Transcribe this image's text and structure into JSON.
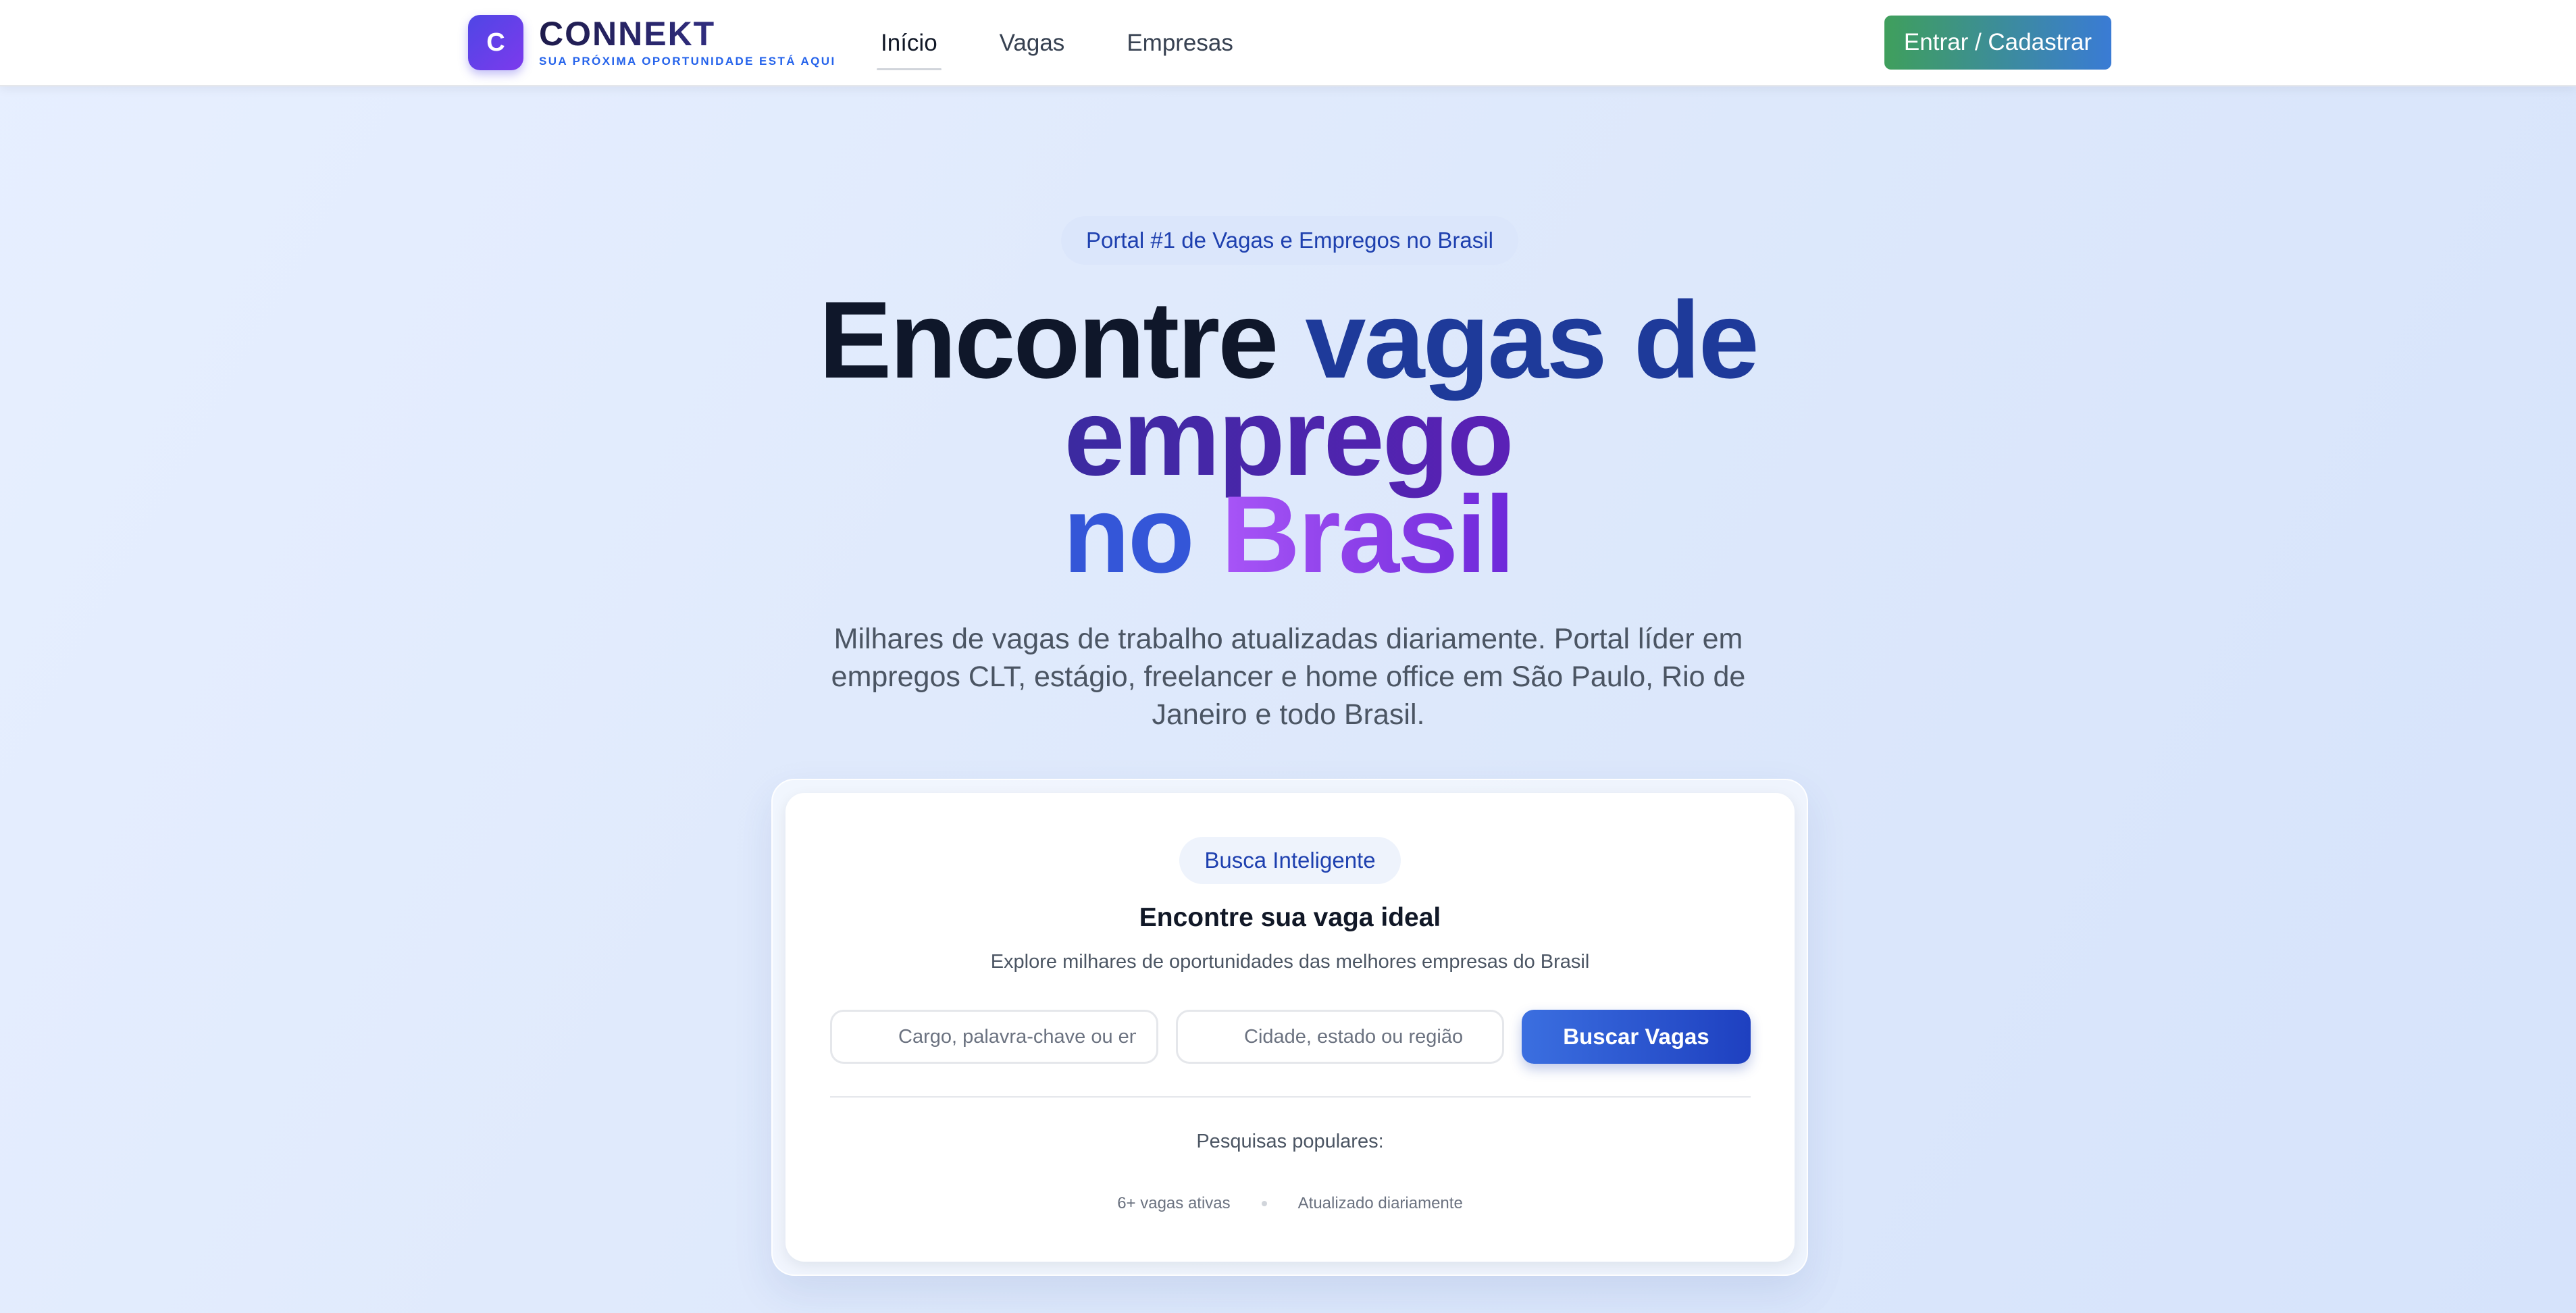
{
  "brand": {
    "initial": "C",
    "name": "CONNEKT",
    "tagline": "SUA PRÓXIMA OPORTUNIDADE ESTÁ AQUI"
  },
  "nav": {
    "items": [
      {
        "label": "Início",
        "active": true
      },
      {
        "label": "Vagas",
        "active": false
      },
      {
        "label": "Empresas",
        "active": false
      }
    ],
    "cta_label": "Entrar / Cadastrar"
  },
  "hero": {
    "badge": "Portal #1 de Vagas e Empregos no Brasil",
    "title_parts": {
      "p1": "Encontre",
      "p2": "vagas de",
      "p3": "emprego",
      "p4": "no",
      "p5": "Brasil"
    },
    "subtitle": "Milhares de vagas de trabalho atualizadas diariamente. Portal líder em empregos CLT, estágio, freelancer e home office em São Paulo, Rio de Janeiro e todo Brasil."
  },
  "search": {
    "badge": "Busca Inteligente",
    "title": "Encontre sua vaga ideal",
    "subtitle": "Explore milhares de oportunidades das melhores empresas do Brasil",
    "keyword_placeholder": "Cargo, palavra-chave ou empresa",
    "keyword_value": "",
    "location_placeholder": "Cidade, estado ou região",
    "location_value": "",
    "button_label": "Buscar Vagas",
    "popular_label": "Pesquisas populares:",
    "stats": [
      "6+ vagas ativas",
      "Atualizado diariamente"
    ]
  },
  "colors": {
    "accent_blue": "#1e40af",
    "cta_green": "#3f9f5c",
    "brand_purple": "#7c3aed",
    "page_bg": "#e2ebfb"
  }
}
